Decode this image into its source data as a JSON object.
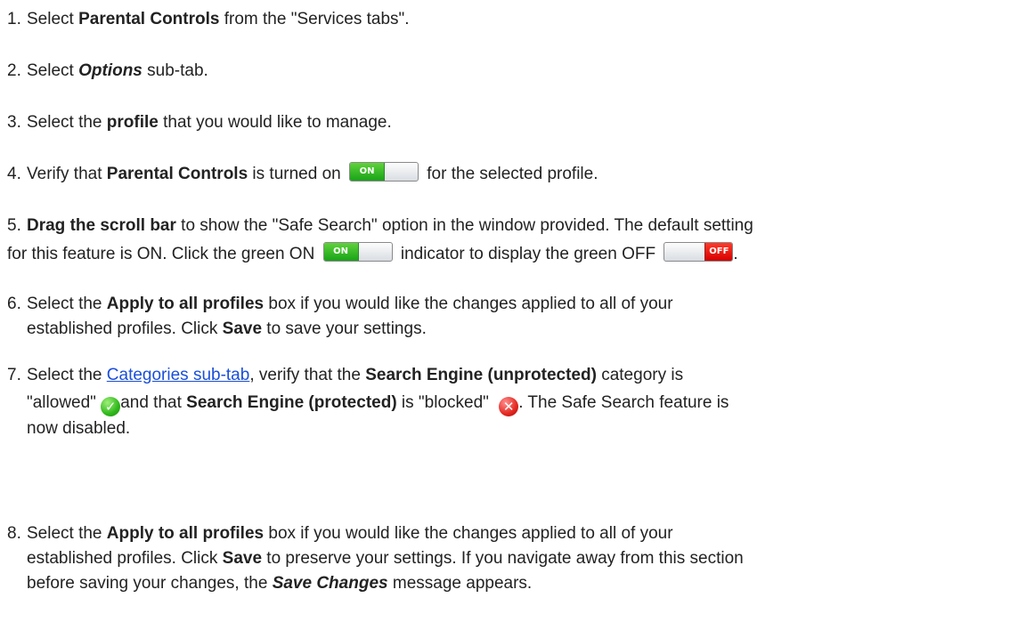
{
  "steps": [
    {
      "n": "1.",
      "a": "Select ",
      "b": "Parental Controls",
      "c": " from the \"Services tabs\"."
    },
    {
      "n": "2.",
      "a": "Select ",
      "b": "Options",
      "c": " sub-tab."
    },
    {
      "n": "3.",
      "a": "Select the ",
      "b": "profile",
      "c": " that you would like to manage."
    },
    {
      "n": "4.",
      "a": "Verify that ",
      "b": "Parental Controls",
      "c": " is turned on ",
      "d": " for the selected profile."
    },
    {
      "n": "5.",
      "b": "Drag the scroll bar",
      "c": " to show the \"Safe Search\" option in the window provided. The default setting",
      "d": "for this feature is ON. Click the green ON ",
      "e": " indicator  to display the green OFF ",
      "f": "."
    },
    {
      "n": "6.",
      "a": "Select the ",
      "b": "Apply to all profiles",
      "c": " box if you would like the changes applied to all of your",
      "d": "established profiles. Click ",
      "e": "Save",
      "f": " to save your settings."
    },
    {
      "n": "7.",
      "a": "Select the ",
      "link": "Categories sub-tab",
      "c": ", verify that the ",
      "b": "Search Engine (unprotected)",
      "d": " category is",
      "e": "\"allowed\" ",
      "f": "and that ",
      "g": "Search Engine (protected)",
      "h": " is \"blocked\" ",
      "i": ". The Safe Search feature is",
      "j": "now disabled."
    },
    {
      "n": "8.",
      "a": "Select the ",
      "b": "Apply to all profiles",
      "c": " box if you would like the changes applied to all of your",
      "d": "established profiles. Click ",
      "e": "Save",
      "f": " to preserve your settings. If you navigate away from this section",
      "g": "before saving your changes, the ",
      "h": "Save Changes",
      "i": " message appears."
    }
  ],
  "toggles": {
    "on_label": "ON",
    "off_label": "OFF"
  },
  "icons": {
    "allowed": "check-icon",
    "blocked": "x-icon",
    "allowed_color": "#2fb81a",
    "blocked_color": "#e3271f",
    "toggle_on_color": "#18a318",
    "toggle_off_color": "#d40000"
  }
}
